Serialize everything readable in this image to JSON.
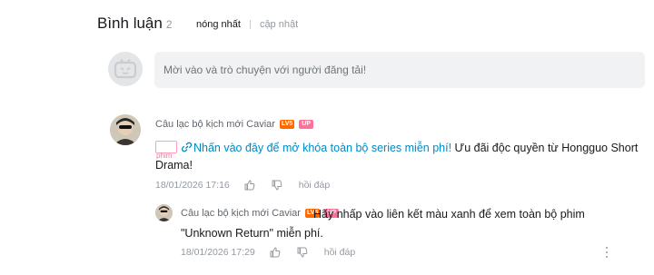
{
  "header": {
    "title": "Bình luận",
    "count": "2",
    "sort_hot": "nóng nhất",
    "sort_new": "cập nhật"
  },
  "composer": {
    "placeholder": "Mời vào và trò chuyện với người đăng tải!"
  },
  "comments": [
    {
      "username": "Câu lạc bộ kịch mới Caviar",
      "level_badge": "LV5",
      "up_badge": "UP",
      "tag_label": "phim",
      "link_text": "Nhấn vào đây để mở khóa toàn bộ series miễn phí!",
      "text": " Ưu đãi độc quyền từ Hongguo Short Drama!",
      "time": "18/01/2026 17:16",
      "reply_label": "hồi đáp"
    },
    {
      "username": "Câu lạc bộ kịch mới Caviar",
      "level_badge": "LV5",
      "up_badge": "UP",
      "text": "Hãy nhấp vào liên kết màu xanh để xem toàn bộ phim \"Unknown Return\" miễn phí.",
      "time": "18/01/2026 17:29",
      "reply_label": "hồi đáp"
    }
  ],
  "colors": {
    "link": "#008ac5",
    "level_badge": "#ff6a00",
    "up_badge": "#fb7299",
    "muted": "#9499a0"
  },
  "icons": {
    "thumb_up": "thumb-up-icon",
    "thumb_down": "thumb-down-icon",
    "link": "link-icon",
    "more": "more-icon"
  }
}
